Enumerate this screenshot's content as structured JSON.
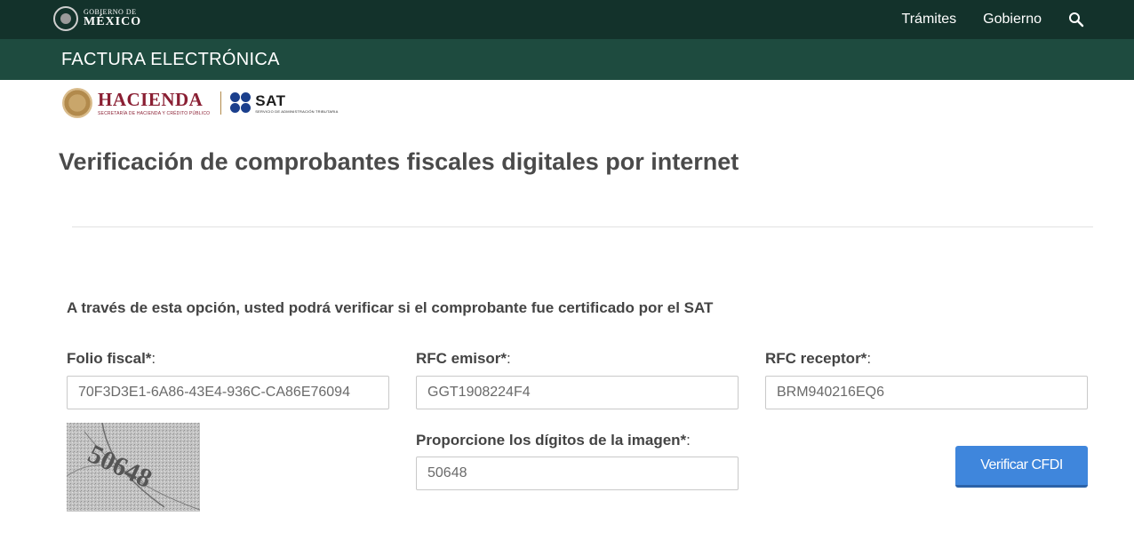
{
  "topbar": {
    "gov_line1": "GOBIERNO DE",
    "gov_line2": "MÉXICO",
    "nav": [
      "Trámites",
      "Gobierno"
    ],
    "search_icon": "search-icon"
  },
  "secbar": {
    "title": "FACTURA ELECTRÓNICA"
  },
  "logos": {
    "hacienda_name": "HACIENDA",
    "hacienda_sub": "SECRETARÍA DE HACIENDA Y CRÉDITO PÚBLICO",
    "sat_name": "SAT",
    "sat_sub": "SERVICIO DE ADMINISTRACIÓN TRIBUTARIA"
  },
  "page": {
    "title": "Verificación de comprobantes fiscales digitales por internet",
    "description": "A través de esta opción, usted podrá verificar si el comprobante fue certificado por el SAT"
  },
  "form": {
    "folio": {
      "label": "Folio fiscal*",
      "value": "70F3D3E1-6A86-43E4-936C-CA86E76094"
    },
    "rfc_emisor": {
      "label": "RFC emisor*",
      "value": "GGT1908224F4"
    },
    "rfc_receptor": {
      "label": "RFC receptor*",
      "value": "BRM940216EQ6"
    },
    "captcha_label": {
      "label": "Proporcione los dígitos de la imagen*",
      "value": "50648"
    },
    "captcha_image_text": "50648",
    "colon": ":",
    "submit": "Verificar CFDI"
  },
  "colors": {
    "topbar": "#13322b",
    "secbar": "#1e4b3f",
    "button": "#3f86dc"
  }
}
